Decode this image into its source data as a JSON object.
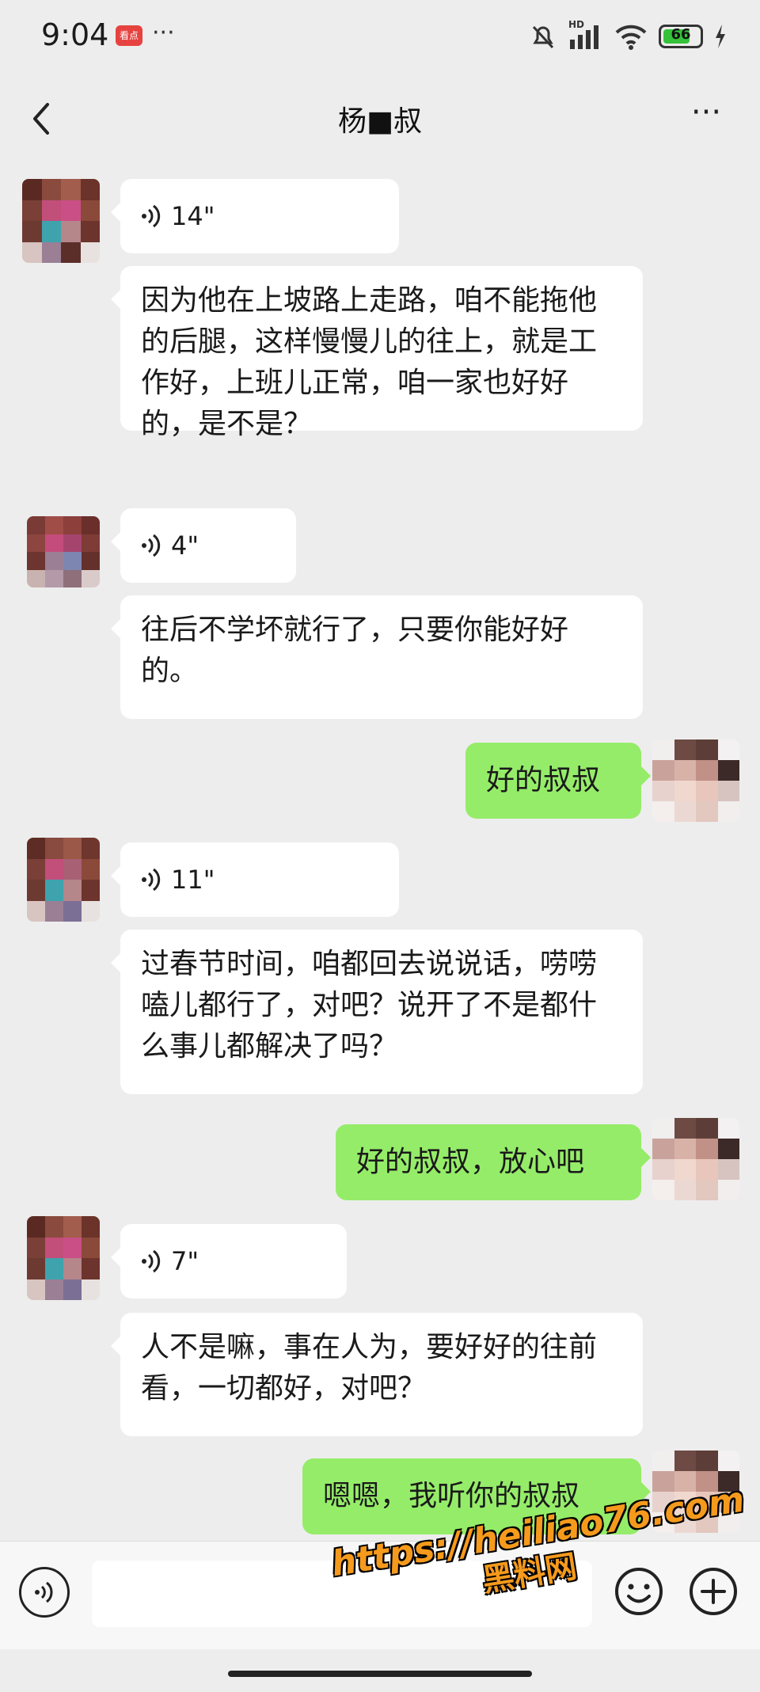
{
  "status_bar": {
    "time": "9:04",
    "badge_text": "看点",
    "more_dots": "···",
    "network_label": "HD",
    "battery": "66"
  },
  "header": {
    "title": "杨■叔",
    "more_label": "···"
  },
  "messages": [
    {
      "side": "in",
      "kind": "voice",
      "duration": "14\""
    },
    {
      "side": "in",
      "kind": "text",
      "text": "因为他在上坡路上走路，咱不能拖他的后腿，这样慢慢儿的往上，就是工作好，上班儿正常，咱一家也好好的，是不是？"
    },
    {
      "side": "in",
      "kind": "voice",
      "duration": "4\""
    },
    {
      "side": "in",
      "kind": "text",
      "text": "往后不学坏就行了，只要你能好好的。"
    },
    {
      "side": "out",
      "kind": "text",
      "text": "好的叔叔"
    },
    {
      "side": "in",
      "kind": "voice",
      "duration": "11\""
    },
    {
      "side": "in",
      "kind": "text",
      "text": "过春节时间，咱都回去说说话，唠唠嗑儿都行了，对吧？说开了不是都什么事儿都解决了吗？"
    },
    {
      "side": "out",
      "kind": "text",
      "text": "好的叔叔，放心吧"
    },
    {
      "side": "in",
      "kind": "voice",
      "duration": "7\""
    },
    {
      "side": "in",
      "kind": "text",
      "text": "人不是嘛，事在人为，要好好的往前看，一切都好，对吧？"
    },
    {
      "side": "out",
      "kind": "text",
      "text": "嗯嗯，我听你的叔叔"
    }
  ],
  "watermark": {
    "url": "https://heiliao76.com",
    "name": "黑料网"
  },
  "colors": {
    "background": "#ededed",
    "incoming_bubble": "#ffffff",
    "outgoing_bubble": "#95ec69",
    "watermark": "#f59a1c"
  }
}
